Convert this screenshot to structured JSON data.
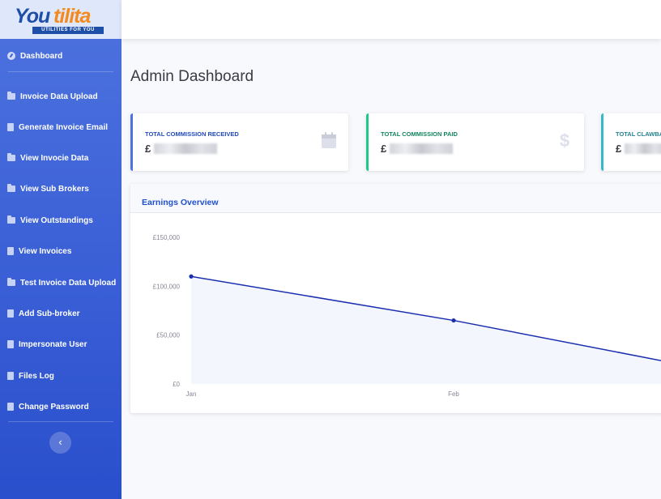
{
  "brand": {
    "logo_you": "You",
    "logo_tilita": "tilita",
    "tagline": "UTILITIES FOR YOU"
  },
  "sidebar": {
    "items": [
      {
        "label": "Dashboard",
        "icon": "dashboard-icon"
      },
      {
        "label": "Invoice Data Upload",
        "icon": "folder-icon"
      },
      {
        "label": "Generate Invoice Email",
        "icon": "file-icon"
      },
      {
        "label": "View Invocie Data",
        "icon": "folder-icon"
      },
      {
        "label": "View Sub Brokers",
        "icon": "folder-icon"
      },
      {
        "label": "View Outstandings",
        "icon": "folder-icon"
      },
      {
        "label": "View Invoices",
        "icon": "file-icon"
      },
      {
        "label": "Test Invoice Data Upload",
        "icon": "folder-icon"
      },
      {
        "label": "Add Sub-broker",
        "icon": "file-icon"
      },
      {
        "label": "Impersonate User",
        "icon": "file-icon"
      },
      {
        "label": "Files Log",
        "icon": "file-icon"
      },
      {
        "label": "Change Password",
        "icon": "file-icon"
      }
    ],
    "toggle_glyph": "‹"
  },
  "page": {
    "title": "Admin Dashboard"
  },
  "cards": [
    {
      "label": "TOTAL COMMISSION RECEIVED",
      "currency": "£",
      "color": "#4e73df",
      "label_color": "#224abe",
      "icon": "calendar-icon"
    },
    {
      "label": "TOTAL COMMISSION PAID",
      "currency": "£",
      "color": "#1cc88a",
      "label_color": "#13855c",
      "icon": "dollar-icon"
    },
    {
      "label": "TOTAL CLAWBA",
      "currency": "£",
      "color": "#36b9cc",
      "label_color": "#258391",
      "icon": ""
    }
  ],
  "earnings": {
    "title": "Earnings Overview"
  },
  "chart_data": {
    "type": "area",
    "categories": [
      "Jan",
      "Feb"
    ],
    "y_ticks": [
      "£0",
      "£50,000",
      "£100,000",
      "£150,000"
    ],
    "ylim": [
      0,
      150000
    ],
    "series": [
      {
        "values": [
          110000,
          65000,
          13000
        ]
      }
    ],
    "line_color": "#1a2fae",
    "fill_color": "#f4f6fd"
  }
}
